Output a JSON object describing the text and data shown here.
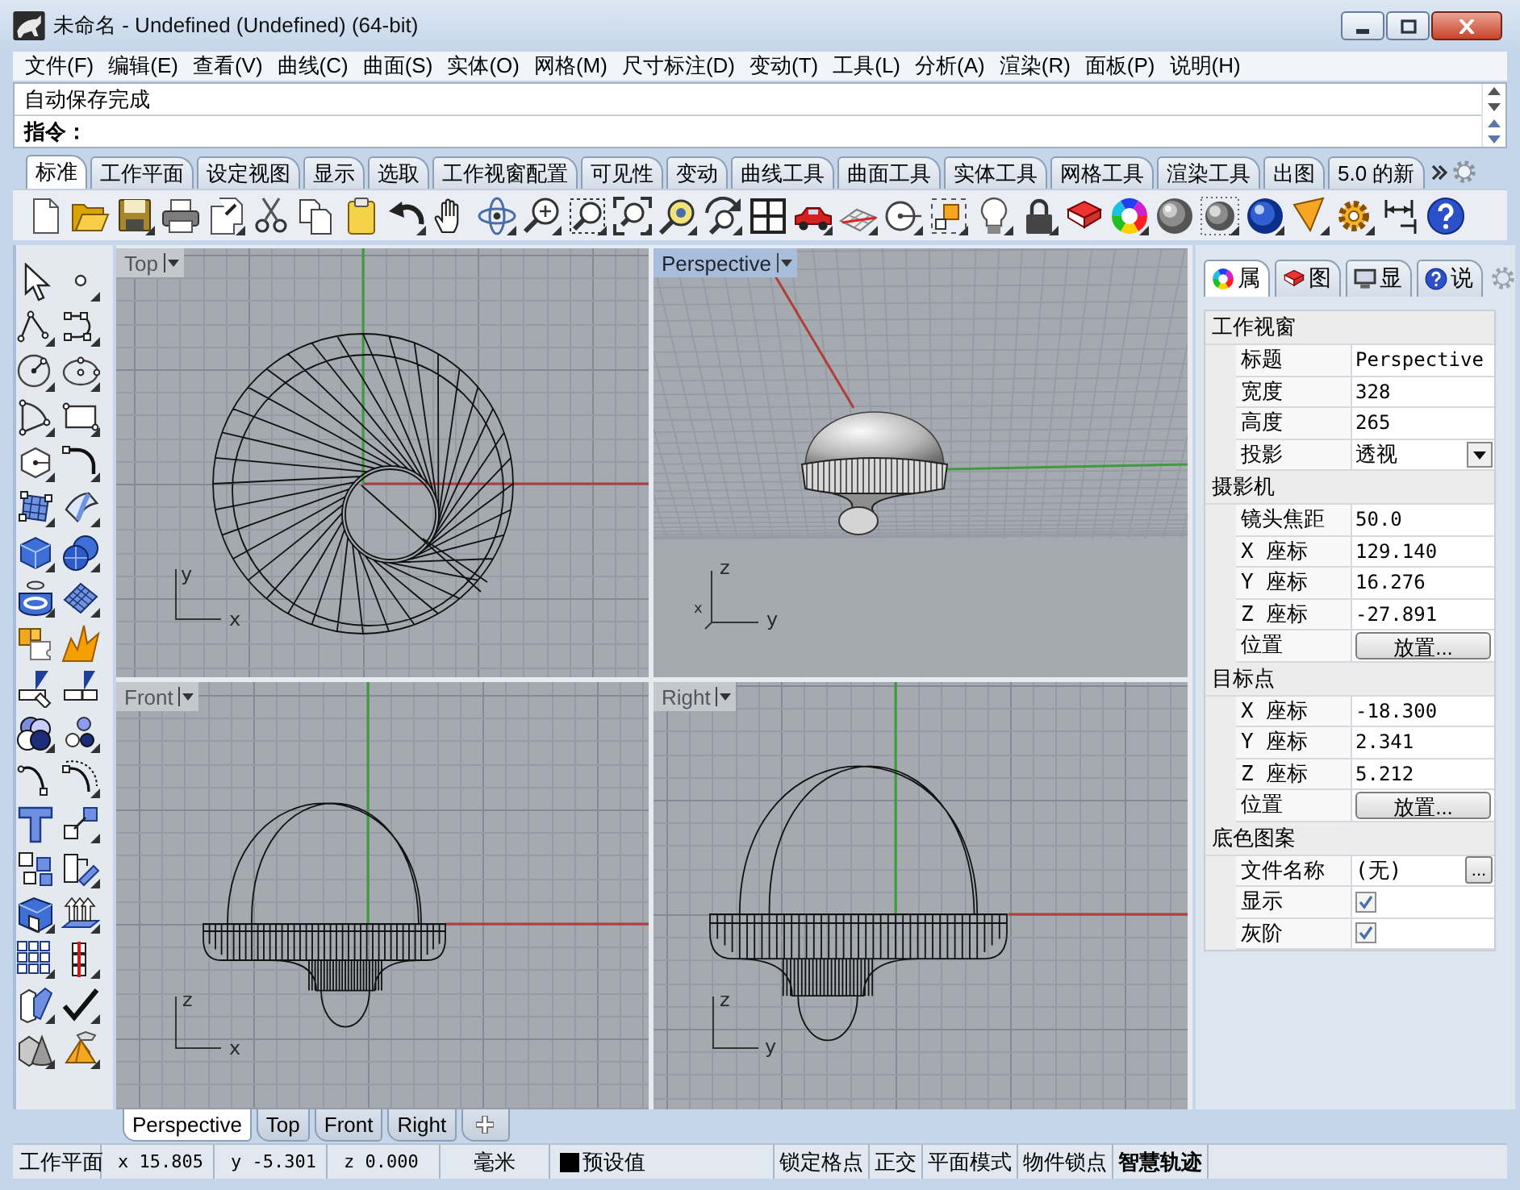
{
  "window": {
    "title": "未命名 - Undefined (Undefined) (64-bit)"
  },
  "menu": [
    "文件(F)",
    "编辑(E)",
    "查看(V)",
    "曲线(C)",
    "曲面(S)",
    "实体(O)",
    "网格(M)",
    "尺寸标注(D)",
    "变动(T)",
    "工具(L)",
    "分析(A)",
    "渲染(R)",
    "面板(P)",
    "说明(H)"
  ],
  "command_area": {
    "history": "自动保存完成",
    "prompt": "指令："
  },
  "toolbar_tabs": [
    {
      "label": "标准",
      "selected": true
    },
    {
      "label": "工作平面",
      "selected": false
    },
    {
      "label": "设定视图",
      "selected": false
    },
    {
      "label": "显示",
      "selected": false
    },
    {
      "label": "选取",
      "selected": false
    },
    {
      "label": "工作视窗配置",
      "selected": false
    },
    {
      "label": "可见性",
      "selected": false
    },
    {
      "label": "变动",
      "selected": false
    },
    {
      "label": "曲线工具",
      "selected": false
    },
    {
      "label": "曲面工具",
      "selected": false
    },
    {
      "label": "实体工具",
      "selected": false
    },
    {
      "label": "网格工具",
      "selected": false
    },
    {
      "label": "渲染工具",
      "selected": false
    },
    {
      "label": "出图",
      "selected": false
    },
    {
      "label": "5.0 的新",
      "selected": false
    }
  ],
  "viewports": [
    {
      "kind": "top",
      "title": "Top",
      "selected": false,
      "axis_labels": [
        "y",
        "x"
      ]
    },
    {
      "kind": "perspective",
      "title": "Perspective",
      "selected": true,
      "axis_labels": [
        "z",
        "x",
        "y"
      ]
    },
    {
      "kind": "front",
      "title": "Front",
      "selected": false,
      "axis_labels": [
        "z",
        "x"
      ]
    },
    {
      "kind": "right",
      "title": "Right",
      "selected": false,
      "axis_labels": [
        "z",
        "y"
      ]
    }
  ],
  "viewport_tabs": [
    {
      "label": "Perspective",
      "selected": true
    },
    {
      "label": "Top",
      "selected": false
    },
    {
      "label": "Front",
      "selected": false
    },
    {
      "label": "Right",
      "selected": false
    }
  ],
  "panel_tabs": [
    {
      "label": "属",
      "selected": true
    },
    {
      "label": "图",
      "selected": false
    },
    {
      "label": "显",
      "selected": false
    },
    {
      "label": "说",
      "selected": false
    }
  ],
  "properties": [
    {
      "title": "工作视窗",
      "rows": [
        {
          "kind": "text",
          "label": "标题",
          "value": "Perspective"
        },
        {
          "kind": "text",
          "label": "宽度",
          "value": "328"
        },
        {
          "kind": "text",
          "label": "高度",
          "value": "265"
        },
        {
          "kind": "dropdown",
          "label": "投影",
          "value": "透视"
        }
      ]
    },
    {
      "title": "摄影机",
      "rows": [
        {
          "kind": "text",
          "label": "镜头焦距",
          "value": "50.0"
        },
        {
          "kind": "text",
          "label": "X 座标",
          "value": "129.140"
        },
        {
          "kind": "text",
          "label": "Y 座标",
          "value": "16.276"
        },
        {
          "kind": "text",
          "label": "Z 座标",
          "value": "-27.891"
        },
        {
          "kind": "button",
          "label": "位置",
          "value": "放置..."
        }
      ]
    },
    {
      "title": "目标点",
      "rows": [
        {
          "kind": "text",
          "label": "X 座标",
          "value": "-18.300"
        },
        {
          "kind": "text",
          "label": "Y 座标",
          "value": "2.341"
        },
        {
          "kind": "text",
          "label": "Z 座标",
          "value": "5.212"
        },
        {
          "kind": "button",
          "label": "位置",
          "value": "放置..."
        }
      ]
    },
    {
      "title": "底色图案",
      "rows": [
        {
          "kind": "file",
          "label": "文件名称",
          "value": "(无)",
          "button": "..."
        },
        {
          "kind": "checkbox",
          "label": "显示",
          "checked": true
        },
        {
          "kind": "checkbox",
          "label": "灰阶",
          "checked": true
        }
      ]
    }
  ],
  "status_bar": {
    "workplane": "工作平面",
    "coordinates": [
      "x 15.805",
      "y -5.301",
      "z 0.000"
    ],
    "units": "毫米",
    "layer": {
      "name": "预设值",
      "color": "#000000"
    },
    "toggles": [
      {
        "label": "锁定格点",
        "on": false
      },
      {
        "label": "正交",
        "on": false
      },
      {
        "label": "平面模式",
        "on": false
      },
      {
        "label": "物件锁点",
        "on": false
      },
      {
        "label": "智慧轨迹",
        "on": true
      }
    ]
  }
}
